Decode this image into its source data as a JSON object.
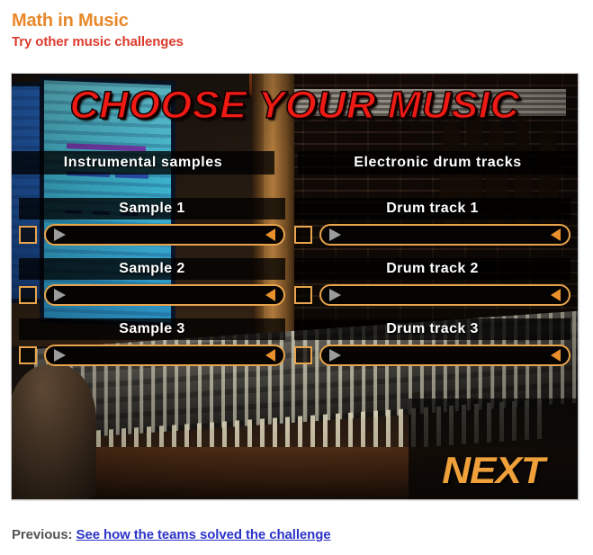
{
  "page": {
    "title": "Math in Music",
    "subtitle": "Try other music challenges"
  },
  "stage": {
    "main_title": "CHOOSE YOUR MUSIC",
    "columns": [
      {
        "header": "Instrumental samples"
      },
      {
        "header": "Electronic drum tracks"
      }
    ],
    "tracks": [
      {
        "left_label": "Sample 1",
        "right_label": "Drum track 1"
      },
      {
        "left_label": "Sample 2",
        "right_label": "Drum track 2"
      },
      {
        "left_label": "Sample 3",
        "right_label": "Drum track 3"
      }
    ],
    "next_label": "NEXT",
    "icons": {
      "play": "play-triangle-icon",
      "volume": "volume-speaker-icon",
      "checkbox": "select-checkbox"
    }
  },
  "footer": {
    "prefix": "Previous:",
    "link_text": "See how the teams solved the challenge"
  },
  "colors": {
    "title_orange": "#E8882B",
    "subtitle_red": "#DC3B2E",
    "main_title_red": "#F01A14",
    "accent_orange": "#E8A44C",
    "next_orange": "#F0A03A",
    "link_blue": "#2C34C8",
    "footer_gray": "#545454"
  }
}
